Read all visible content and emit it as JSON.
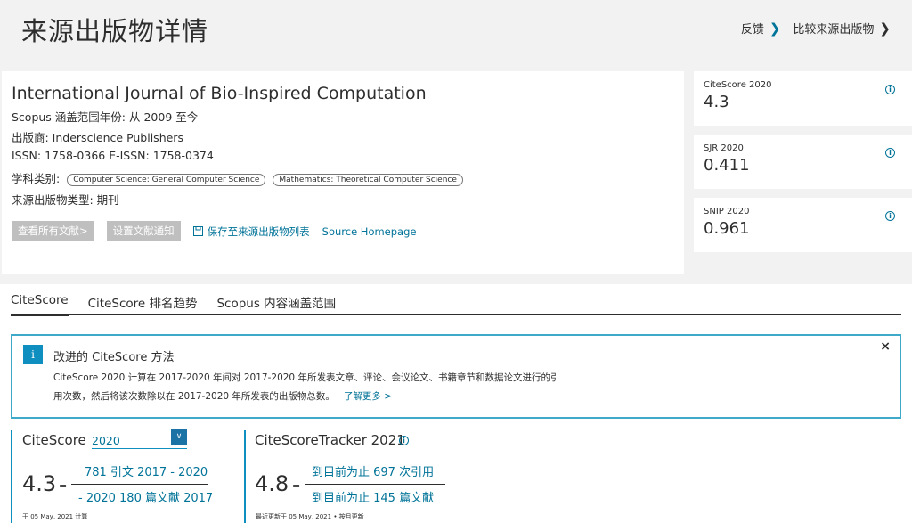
{
  "header": {
    "title": "来源出版物详情",
    "feedback": "反馈",
    "compare": "比较来源出版物"
  },
  "journal": {
    "title": "International Journal of Bio-Inspired Computation",
    "coverage": "Scopus 涵盖范围年份:  从 2009 至今",
    "publisher": "出版商:   Inderscience Publishers",
    "issn": "ISSN:   1758-0366   E-ISSN:   1758-0374",
    "subject_label": "学科类别:",
    "subjects": [
      "Computer Science: General Computer Science",
      "Mathematics: Theoretical Computer Science"
    ],
    "type": "来源出版物类型:   期刊",
    "buttons": {
      "view_all": "查看所有文献>",
      "set_alert": "设置文献通知",
      "save_list": "保存至来源出版物列表",
      "homepage": "Source Homepage"
    }
  },
  "metrics": [
    {
      "label": "CiteScore 2020",
      "value": "4.3"
    },
    {
      "label": "SJR 2020",
      "value": "0.411"
    },
    {
      "label": "SNIP 2020",
      "value": "0.961"
    }
  ],
  "tabs": [
    "CiteScore",
    "CiteScore 排名趋势",
    "Scopus 内容涵盖范围"
  ],
  "notice": {
    "title": "改进的 CiteScore 方法",
    "body_line1": "CiteScore 2020 计算在 2017-2020 年间对 2017-2020 年所发表文章、评论、会议论文、书籍章节和数据论文进行的引",
    "body_line2": "用次数，然后将该次数除以在 2017-2020 年所发表的出版物总数。",
    "more": "了解更多 >"
  },
  "citescore": {
    "title": "CiteScore",
    "year": "2020",
    "value": "4.3",
    "equals": "=",
    "numerator": "781 引文 2017 - 2020",
    "denominator": "- 2020 180 篇文献 2017",
    "note": "于 05 May, 2021 计算"
  },
  "tracker": {
    "title": "CiteScoreTracker 2021",
    "value": "4.8",
    "equals": "=",
    "numerator": "到目前为止 697 次引用",
    "denominator": "到目前为止 145 篇文献",
    "note": "最近更新于 05 May, 2021 • 按月更新"
  }
}
